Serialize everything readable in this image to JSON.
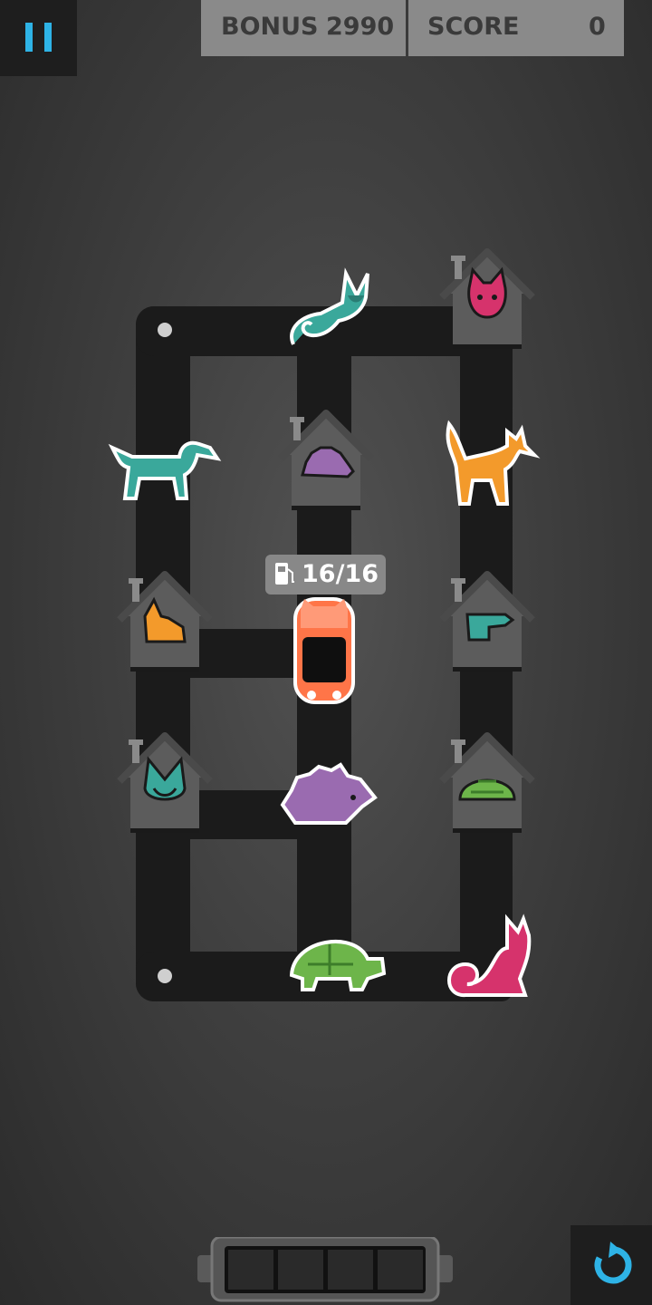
{
  "hud": {
    "bonus_label": "BONUS",
    "bonus_value": "2990",
    "score_label": "SCORE",
    "score_value": "0"
  },
  "car": {
    "fuel": "16/16",
    "fuel_icon": "fuel-pump-icon",
    "color": "#ff7548"
  },
  "animals": [
    {
      "name": "chameleon",
      "color": "#3aa89b"
    },
    {
      "name": "dachshund",
      "color": "#3aa89b"
    },
    {
      "name": "fox",
      "color": "#f39a2b"
    },
    {
      "name": "hedgehog",
      "color": "#9a6bb0"
    },
    {
      "name": "turtle",
      "color": "#6db54a"
    },
    {
      "name": "cat",
      "color": "#d6336c"
    }
  ],
  "houses": [
    {
      "resident": "cat",
      "color": "#d6336c"
    },
    {
      "resident": "hedgehog",
      "color": "#9a6bb0"
    },
    {
      "resident": "fox",
      "color": "#f39a2b"
    },
    {
      "resident": "dachshund",
      "color": "#3aa89b"
    },
    {
      "resident": "chameleon",
      "color": "#3aa89b"
    },
    {
      "resident": "turtle",
      "color": "#6db54a"
    }
  ],
  "inventory": {
    "slots": 4
  },
  "colors": {
    "accent": "#2eb3e6",
    "road": "#1a1a1a"
  }
}
